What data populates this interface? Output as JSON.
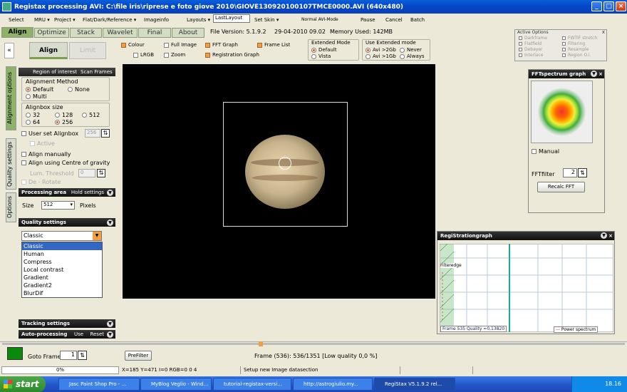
{
  "window": {
    "title": "Registax processing AVI: C:\\file iris\\riprese  e foto giove 2010\\GIOVE130920100107TMCE0000.AVI (640x480)"
  },
  "menu": [
    "Select",
    "MRU ▾",
    "Project ▾",
    "Flat/Dark/Reference ▾",
    "Imageinfo",
    "Layouts ▾",
    "LastLayout",
    "Set Skin ▾",
    "Normal AVI-Mode",
    "Pause",
    "Cancel",
    "Batch"
  ],
  "tabs": [
    "Align",
    "Optimize",
    "Stack",
    "Wavelet",
    "Final",
    "About"
  ],
  "fileinfo": {
    "version": "File Version: 5.1.9.2",
    "date": "29-04-2010 09.02",
    "memory": "Memory Used: 142MB"
  },
  "active_options": {
    "title": "Active Options",
    "items": [
      "Darkframe",
      "Flatfield",
      "Debayer",
      "Interlace",
      "FWTIF stretch",
      "Filtering",
      "Resample",
      "Region O.I."
    ]
  },
  "toolbar": {
    "align": "Align",
    "limit": "Limit",
    "colour": "Colour",
    "lrgb": "LRGB",
    "fullimage": "Full Image",
    "zoom": "Zoom",
    "fftgraph": "FFT Graph",
    "reggraph": "Registration Graph",
    "framelist": "Frame List",
    "extmode": "Extended Mode",
    "default": "Default",
    "vista": "Vista",
    "useext": "Use Extended mode",
    "avi2gb": "Avi >2Gb",
    "avi1gb": "Avi >1Gb",
    "never": "Never",
    "always": "Always"
  },
  "sidetabs": [
    "Alignment options",
    "Quality settings",
    "Options"
  ],
  "left": {
    "roi": "Region of interest",
    "scanframes": "Scan Frames",
    "method": "Alignment Method",
    "m_default": "Default",
    "m_none": "None",
    "m_multi": "Multi",
    "boxsize": "Alignbox size",
    "s32": "32",
    "s128": "128",
    "s512": "512",
    "s64": "64",
    "s256": "256",
    "userbox": "User set Alignbox",
    "userval": "256",
    "active": "Active",
    "manual": "Align manually",
    "cog": "Align using Centre of gravity",
    "lum": "Lum. Threshold",
    "lumval": "0",
    "derotate": "De - Rotate",
    "proc": "Processing area",
    "hold": "Hold settings",
    "size": "Size",
    "sizeval": "512",
    "pixels": "Pixels",
    "quality": "Quality settings",
    "qsel": "Classic",
    "qopts": [
      "Classic",
      "Human",
      "Compress",
      "Local contrast",
      "Gradient",
      "Gradient2",
      "BlurDif"
    ],
    "tracking": "Tracking settings",
    "auto": "Auto-processing",
    "use": "Use",
    "reset": "Reset"
  },
  "fft": {
    "title": "FFTspectrum graph",
    "manual": "Manual",
    "filter": "FFTfilter",
    "filterval": "2",
    "recalc": "Recalc FFT"
  },
  "reg": {
    "title": "RegiStrationgraph",
    "edge": "Filteredge",
    "quality": "Frame 535 Quality =0,13820",
    "legend": "Power spectrum"
  },
  "bottom": {
    "goto": "Goto Frame",
    "gotoval": "1",
    "prefilter": "PreFilter",
    "frameinfo": "Frame (536): 536/1351 [Low quality 0,0 %]"
  },
  "status": {
    "progress": "0%",
    "progress_fraction": 0,
    "coords": "X=185 Y=471 I=0 RGB=0 0 4",
    "msg": "Setup new Image datasection"
  },
  "taskbar": {
    "start": "start",
    "items": [
      "Jasc Paint Shop Pro - ...",
      "MyBlog Veglio - Wind...",
      "tutorial-registax-versi...",
      "http://astrogiulio.my...",
      "RegiStax V5.1.9.2 rel..."
    ],
    "time": "18.16"
  },
  "colors": {
    "accent": "#8fb26b",
    "curve": "#1aaa9a"
  }
}
